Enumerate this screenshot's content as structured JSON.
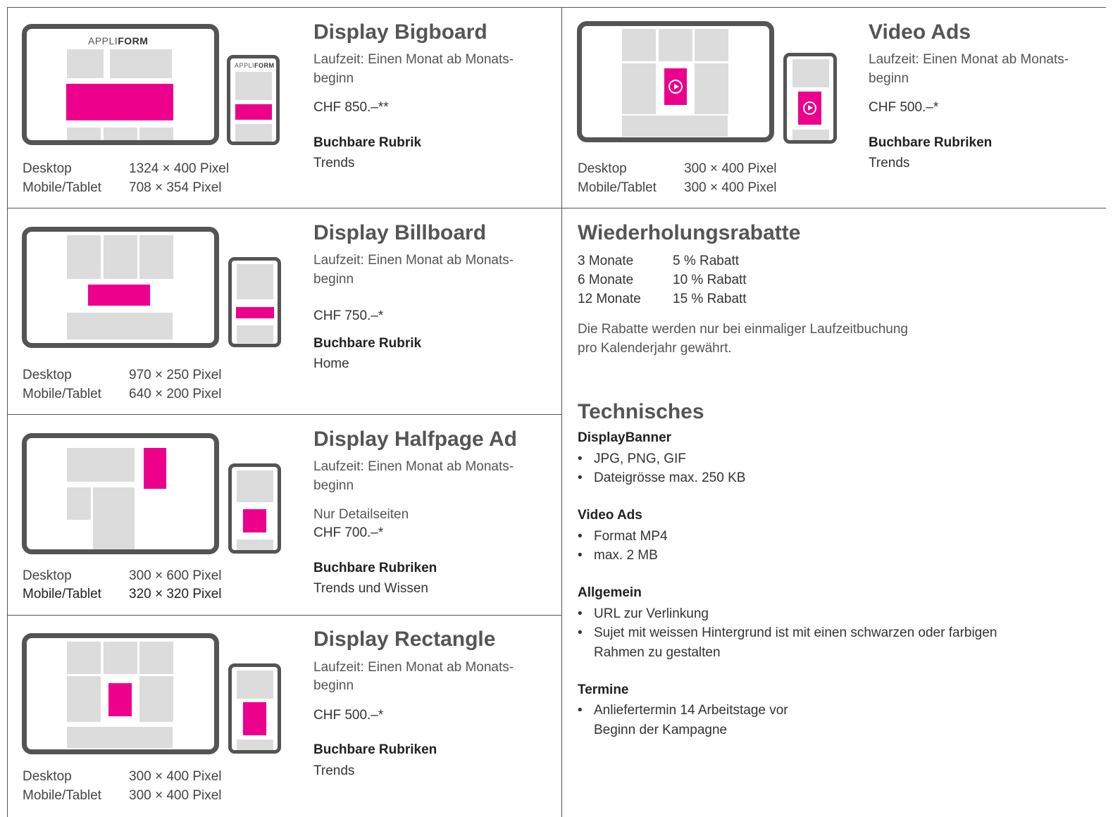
{
  "ads": [
    {
      "title": "Display Bigboard",
      "runtime1": "Laufzeit: Einen Monat ab Monats-",
      "runtime2": "beginn",
      "price": "CHF 850.–**",
      "rubric_label": "Buchbare Rubrik",
      "rubric_value": "Trends",
      "desktop_label": "Desktop",
      "desktop_size": "1324 × 400 Pixel",
      "mobile_label": "Mobile/Tablet",
      "mobile_size": "708 × 354 Pixel"
    },
    {
      "title": "Display Billboard",
      "runtime1": "Laufzeit: Einen Monat ab Monats-",
      "runtime2": "beginn",
      "price": "CHF 750.–*",
      "rubric_label": "Buchbare Rubrik",
      "rubric_value": "Home",
      "desktop_label": "Desktop",
      "desktop_size": "970 × 250 Pixel",
      "mobile_label": "Mobile/Tablet",
      "mobile_size": "640 × 200 Pixel"
    },
    {
      "title": "Display Halfpage Ad",
      "runtime1": "Laufzeit: Einen Monat ab Monats-",
      "runtime2": "beginn",
      "note": "Nur Detailseiten",
      "price": "CHF 700.–*",
      "rubric_label": "Buchbare Rubriken",
      "rubric_value": "Trends und Wissen",
      "desktop_label": "Desktop",
      "desktop_size": "300 × 600 Pixel",
      "mobile_label": "Mobile/Tablet",
      "mobile_size": "320 × 320 Pixel"
    },
    {
      "title": "Display Rectangle",
      "runtime1": "Laufzeit: Einen Monat ab Monats-",
      "runtime2": "beginn",
      "price": "CHF 500.–*",
      "rubric_label": "Buchbare Rubriken",
      "rubric_value": "Trends",
      "desktop_label": "Desktop",
      "desktop_size": "300 × 400 Pixel",
      "mobile_label": "Mobile/Tablet",
      "mobile_size": "300 × 400 Pixel"
    },
    {
      "title": "Video Ads",
      "runtime1": "Laufzeit: Einen Monat ab Monats-",
      "runtime2": "beginn",
      "price": "CHF 500.–*",
      "rubric_label": "Buchbare Rubriken",
      "rubric_value": "Trends",
      "desktop_label": "Desktop",
      "desktop_size": "300 × 400 Pixel",
      "mobile_label": "Mobile/Tablet",
      "mobile_size": "300 × 400 Pixel"
    }
  ],
  "logo": {
    "light": "APPLI",
    "bold": "FORM"
  },
  "discounts": {
    "title": "Wiederholungsrabatte",
    "rows": [
      {
        "period": "3 Monate",
        "rate": "5 % Rabatt"
      },
      {
        "period": "6 Monate",
        "rate": "10 % Rabatt"
      },
      {
        "period": "12 Monate",
        "rate": "15 % Rabatt"
      }
    ],
    "note1": "Die Rabatte werden nur bei einmaliger Laufzeitbuchung",
    "note2": "pro Kalenderjahr gewährt."
  },
  "tech": {
    "title": "Technisches",
    "sections": [
      {
        "heading": "DisplayBanner",
        "items": [
          "JPG, PNG, GIF",
          "Dateigrösse max. 250 KB"
        ]
      },
      {
        "heading": "Video Ads",
        "items": [
          "Format MP4",
          "max. 2 MB"
        ]
      },
      {
        "heading": "Allgemein",
        "items": [
          "URL zur Verlinkung",
          "Sujet mit weissen Hintergrund ist mit einen schwarzen oder farbigen",
          "Rahmen zu gestalten"
        ]
      },
      {
        "heading": "Termine",
        "items": [
          "Anliefertermin 14 Arbeitstage vor",
          "Beginn der Kampagne"
        ]
      }
    ],
    "bullet": "•"
  },
  "colors": {
    "accent": "#ec008c",
    "device": "#545454",
    "placeholder": "#dcdcdc"
  }
}
